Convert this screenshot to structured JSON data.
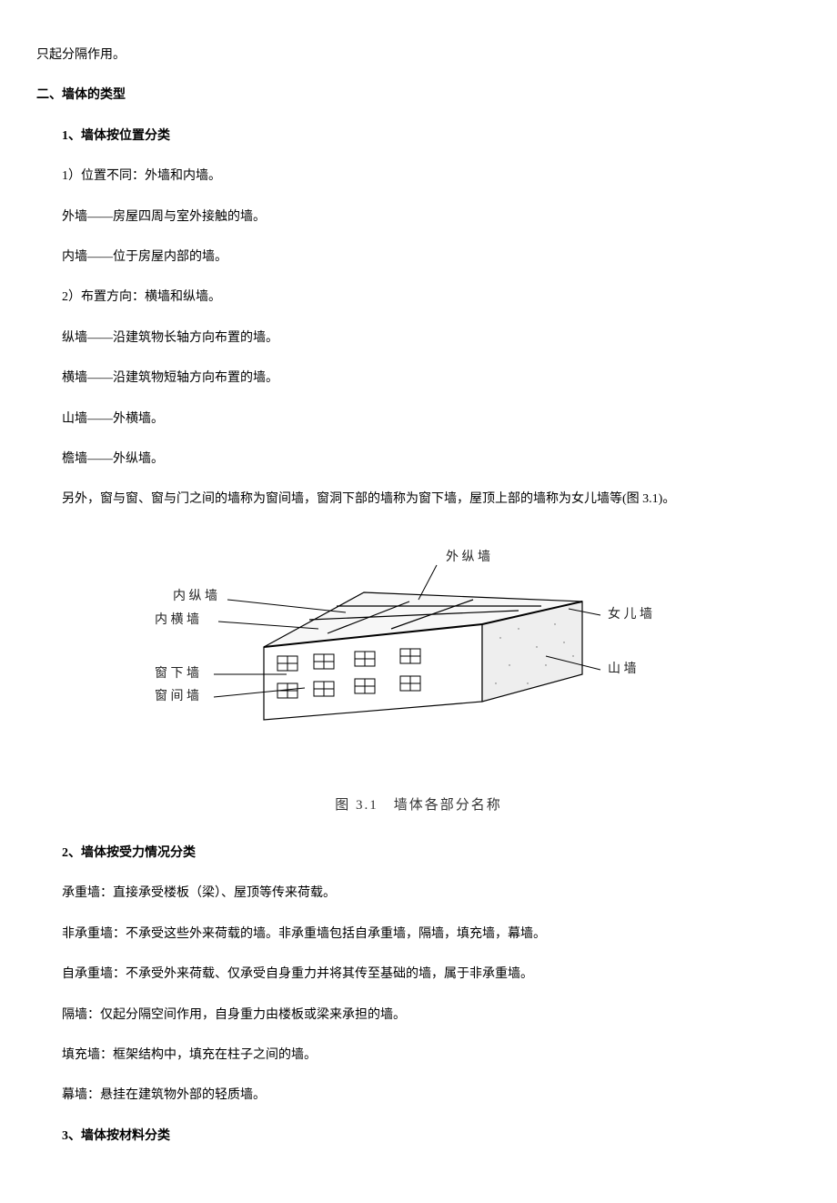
{
  "p_top": "只起分隔作用。",
  "h1": "二、墙体的类型",
  "s1": {
    "title": "1、墙体按位置分类",
    "l1": "1）位置不同：外墙和内墙。",
    "l2": "外墙——房屋四周与室外接触的墙。",
    "l3": "内墙——位于房屋内部的墙。",
    "l4": "2）布置方向：横墙和纵墙。",
    "l5": "纵墙——沿建筑物长轴方向布置的墙。",
    "l6": "横墙——沿建筑物短轴方向布置的墙。",
    "l7": "山墙——外横墙。",
    "l8": "檐墙——外纵墙。",
    "l9": "另外，窗与窗、窗与门之间的墙称为窗间墙，窗洞下部的墙称为窗下墙，屋顶上部的墙称为女儿墙等(图 3.1)。"
  },
  "figure": {
    "caption": "图 3.1　墙体各部分名称",
    "labels": {
      "neizong": "内 纵 墙",
      "neiheng": "内 横 墙",
      "chuangxia": "窗 下 墙",
      "chuangjian": "窗 间 墙",
      "waizong": "外 纵 墙",
      "nver": "女 儿 墙",
      "shan": "山 墙"
    }
  },
  "s2": {
    "title": "2、墙体按受力情况分类",
    "l1": "承重墙：直接承受楼板（梁）、屋顶等传来荷载。",
    "l2": "非承重墙：不承受这些外来荷载的墙。非承重墙包括自承重墙，隔墙，填充墙，幕墙。",
    "l3": "自承重墙：不承受外来荷载、仅承受自身重力并将其传至基础的墙，属于非承重墙。",
    "l4": "隔墙：仅起分隔空间作用，自身重力由楼板或梁来承担的墙。",
    "l5": "填充墙：框架结构中，填充在柱子之间的墙。",
    "l6": "幕墙：悬挂在建筑物外部的轻质墙。"
  },
  "s3": {
    "title": "3、墙体按材料分类"
  }
}
